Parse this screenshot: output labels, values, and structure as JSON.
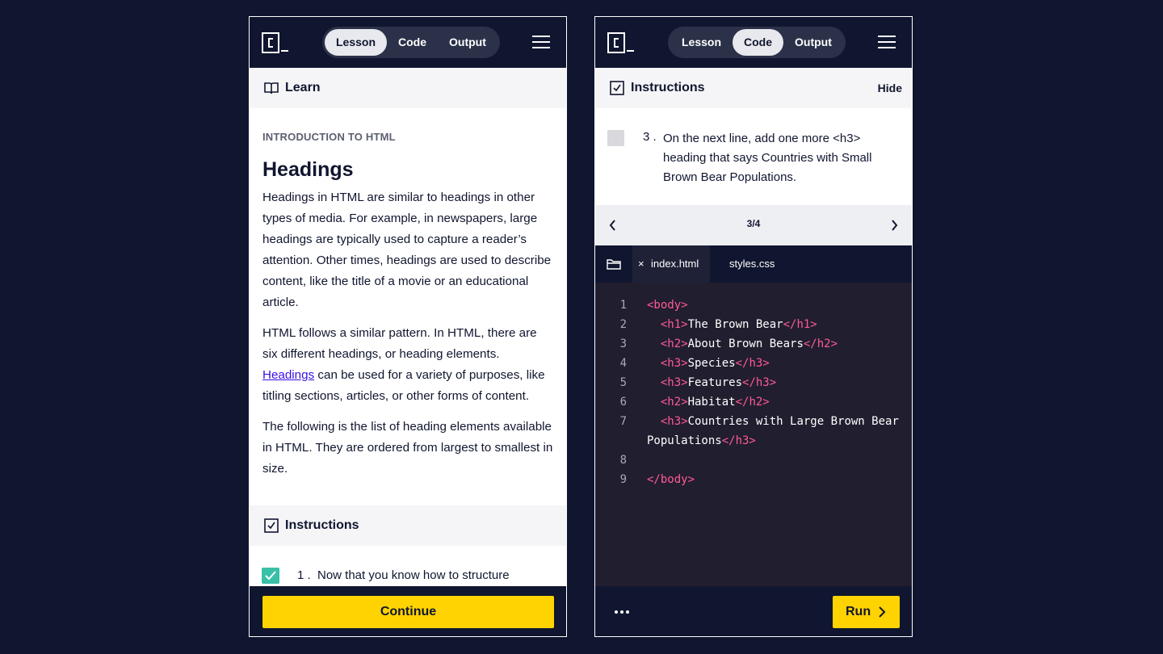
{
  "colors": {
    "background": "#10162f",
    "accent": "#ffd300",
    "done_check": "#39c0a7",
    "code_tag": "#ff5a98",
    "link": "#3a10e5"
  },
  "left_panel": {
    "logo_icon": "codecademy-logo-icon",
    "tabs": [
      "Lesson",
      "Code",
      "Output"
    ],
    "active_tab": "Lesson",
    "learn_label": "Learn",
    "eyebrow": "INTRODUCTION TO HTML",
    "title": "Headings",
    "para1": "Headings in HTML are similar to headings in other types of media. For example, in newspapers, large headings are typically used to capture a reader’s attention. Other times, headings are used to describe content, like the title of a movie or an educational article.",
    "para2_a": "HTML follows a similar pattern. In HTML, there are six different headings, or heading elements.",
    "para2_link": "Headings",
    "para2_b": "can be used for a variety of purposes, like titling sections, articles, or other forms of content.",
    "para3": "The following is the list of heading elements available in HTML. They are ordered from largest to smallest in size.",
    "instructions_label": "Instructions",
    "task_number": "1 .",
    "task_text": "Now that you know how to structure",
    "task_done": true,
    "continue_label": "Continue"
  },
  "right_panel": {
    "tabs": [
      "Lesson",
      "Code",
      "Output"
    ],
    "active_tab": "Code",
    "instructions_label": "Instructions",
    "hide_label": "Hide",
    "task_number": "3 .",
    "task_text": "On the next line, add one more <h3> heading that says Countries with Small Brown Bear Populations.",
    "task_done": false,
    "pager": "3/4",
    "file_tabs": [
      "index.html",
      "styles.css"
    ],
    "active_file": "index.html",
    "close_glyph": "×",
    "code_lines": [
      {
        "n": "1",
        "open": "<body>",
        "text": "",
        "close": "",
        "indent": ""
      },
      {
        "n": "2",
        "open": "<h1>",
        "text": "The Brown Bear",
        "close": "</h1>",
        "indent": "  "
      },
      {
        "n": "3",
        "open": "<h2>",
        "text": "About Brown Bears",
        "close": "</h2>",
        "indent": "  "
      },
      {
        "n": "4",
        "open": "<h3>",
        "text": "Species",
        "close": "</h3>",
        "indent": "  "
      },
      {
        "n": "5",
        "open": "<h3>",
        "text": "Features",
        "close": "</h3>",
        "indent": "  "
      },
      {
        "n": "6",
        "open": "<h2>",
        "text": "Habitat",
        "close": "</h2>",
        "indent": "  "
      },
      {
        "n": "7",
        "open": "<h3>",
        "text": "Countries with Large Brown Bear",
        "close": "",
        "indent": "  "
      },
      {
        "n": "",
        "open": "",
        "text": "Populations",
        "close": "</h3>",
        "indent": ""
      },
      {
        "n": "8",
        "open": "",
        "text": "",
        "close": "",
        "indent": ""
      },
      {
        "n": "9",
        "open": "",
        "text": "",
        "close": "</body>",
        "indent": ""
      }
    ],
    "run_label": "Run"
  }
}
